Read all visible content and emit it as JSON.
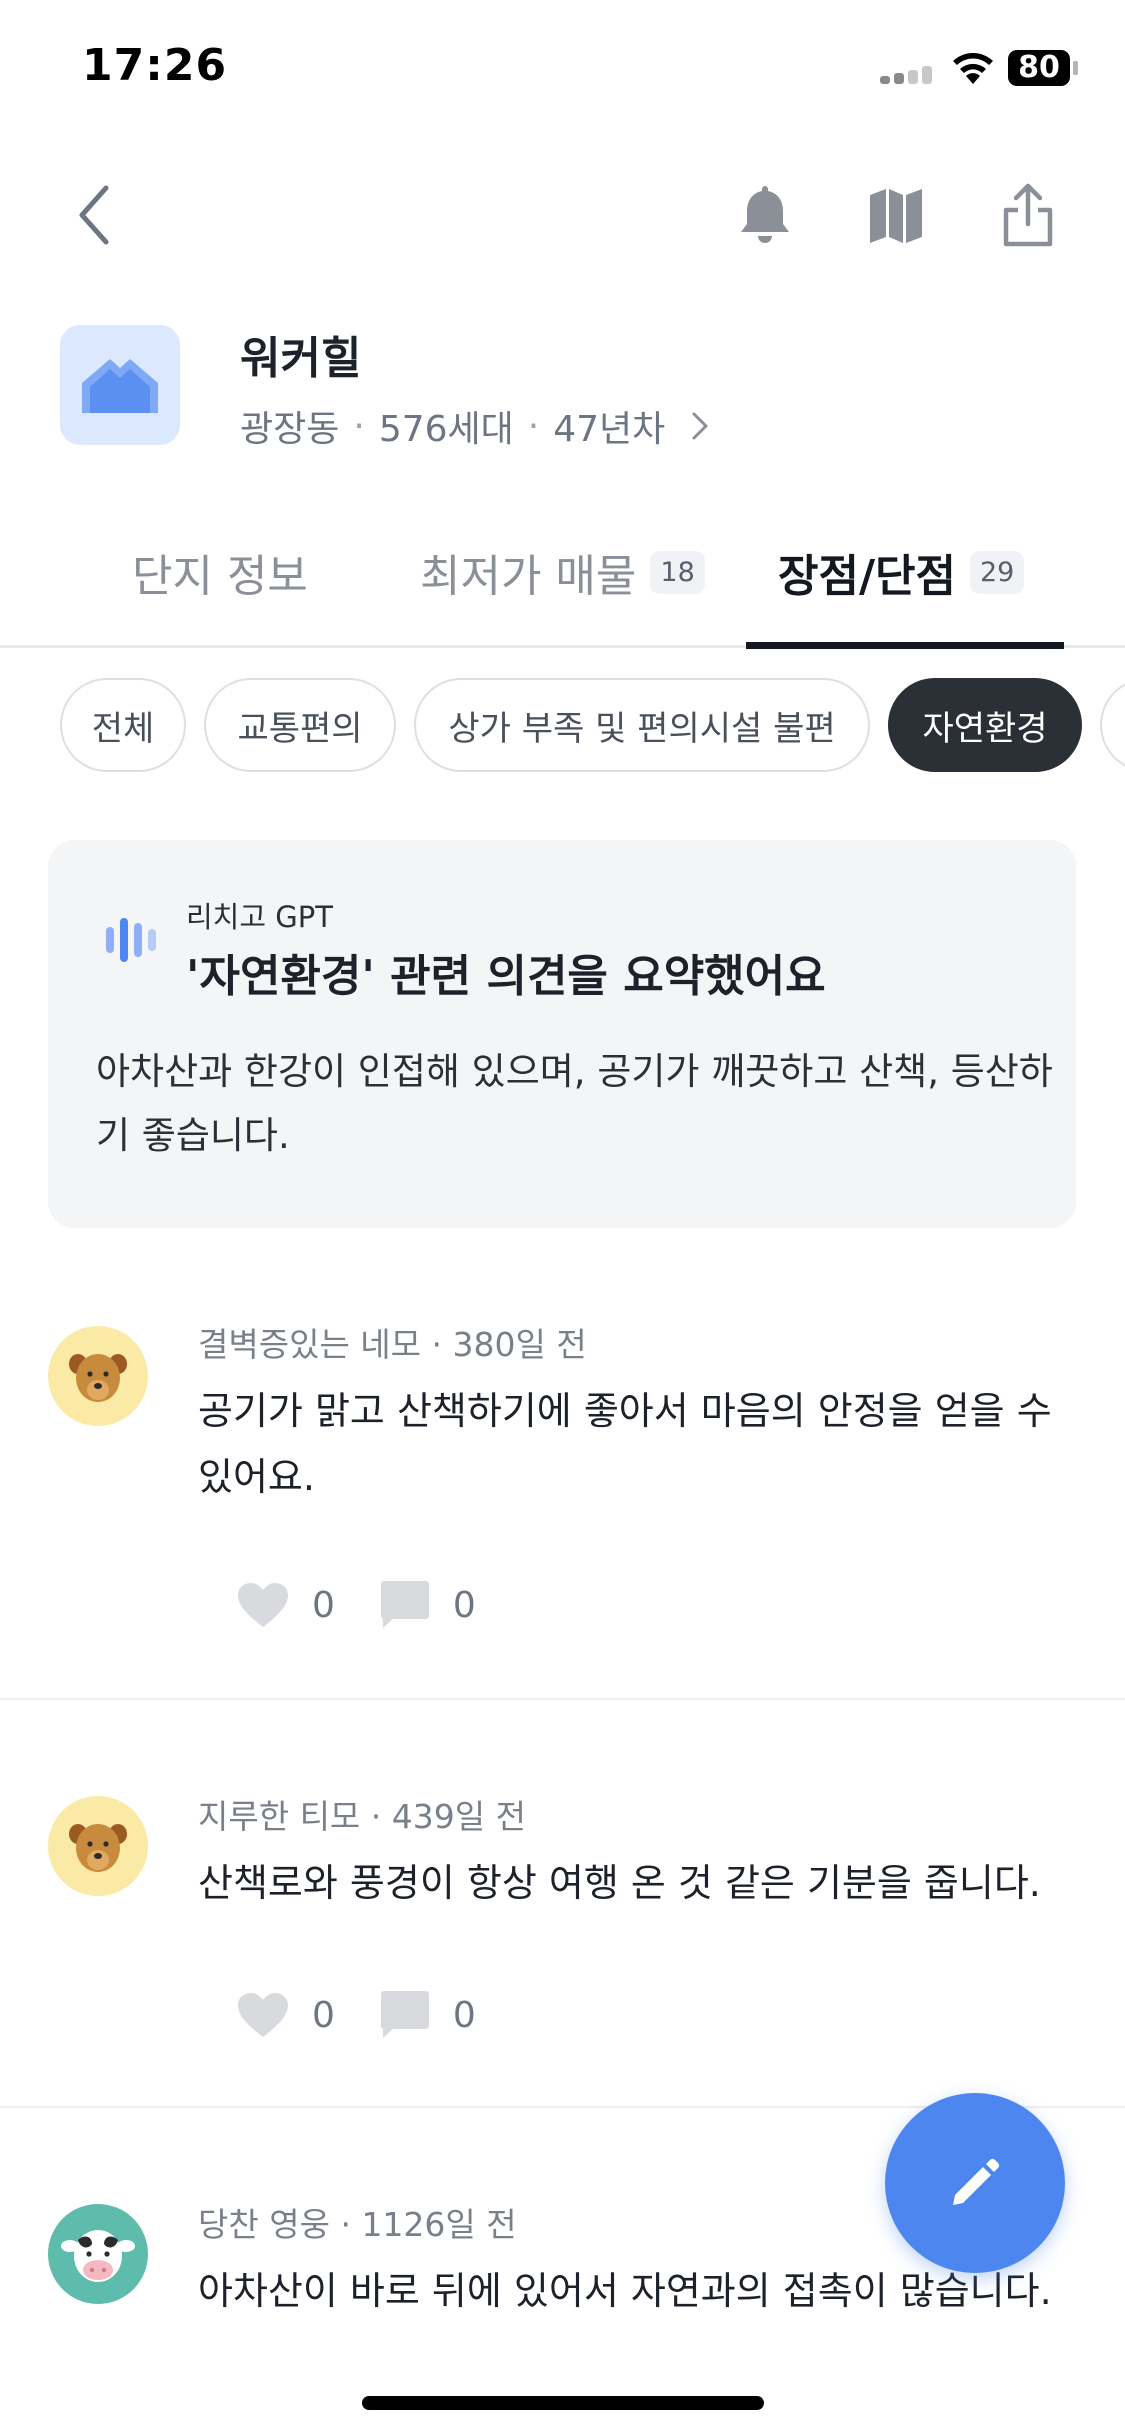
{
  "status_bar": {
    "time": "17:26",
    "battery": "80"
  },
  "complex": {
    "name": "워커힐",
    "location": "광장동",
    "households": "576세대",
    "age": "47년차",
    "separator": "·"
  },
  "tabs": [
    {
      "label": "단지 정보",
      "count": ""
    },
    {
      "label": "최저가 매물",
      "count": "18"
    },
    {
      "label": "장점/단점",
      "count": "29",
      "active": true
    }
  ],
  "filters": [
    {
      "label": "전체"
    },
    {
      "label": "교통편의"
    },
    {
      "label": "상가 부족 및 편의시설 불편"
    },
    {
      "label": "자연환경",
      "selected": true
    }
  ],
  "summary": {
    "source": "리치고 GPT",
    "title": "'자연환경' 관련 의견을 요약했어요",
    "body": "아차산과 한강이 인접해 있으며, 공기가 깨끗하고 산책, 등산하기 좋습니다."
  },
  "reviews": [
    {
      "author": "결벽증있는 네모",
      "time": "380일 전",
      "text": "공기가 맑고 산책하기에 좋아서 마음의 안정을 얻을 수 있어요.",
      "likes": "0",
      "comments": "0",
      "avatar": "dog-icon"
    },
    {
      "author": "지루한 티모",
      "time": "439일 전",
      "text": "산책로와 풍경이 항상 여행 온 것 같은 기분을 줍니다.",
      "likes": "0",
      "comments": "0",
      "avatar": "dog-icon"
    },
    {
      "author": "당찬 영웅",
      "time": "1126일 전",
      "text": "아차산이 바로 뒤에 있어서 자연과의 접촉이 많습니다.",
      "avatar": "cow-icon"
    }
  ],
  "colors": {
    "accent": "#4d86ef",
    "selected_chip": "#2b2f36",
    "card_bg": "#f4f5f7",
    "thumb_bg": "#dbe8fd"
  }
}
